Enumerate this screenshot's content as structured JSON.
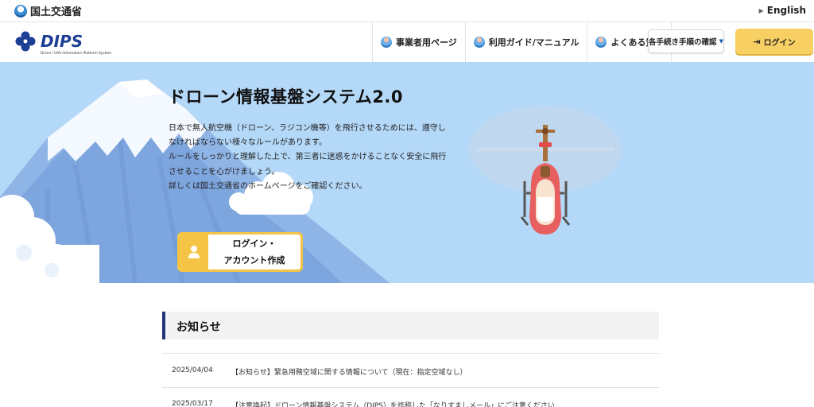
{
  "topbar": {
    "ministry_name": "国土交通省",
    "language_link": "English"
  },
  "header": {
    "logo_text": "DIPS",
    "logo_subtitle": "Drone / UAS Information Platform System",
    "nav": [
      {
        "label": "事業者用ページ",
        "icon": "person-icon"
      },
      {
        "label": "利用ガイド/マニュアル",
        "icon": "person-icon"
      },
      {
        "label": "よくある質問",
        "icon": "person-icon"
      }
    ],
    "procedure_button": "各手続き手順の確認",
    "login_button": "ログイン"
  },
  "hero": {
    "title": "ドローン情報基盤システム2.0",
    "description": [
      "日本で無人航空機（ドローン、ラジコン機等）を飛行させるためには、遵守し",
      "なければならない様々なルールがあります。",
      "ルールをしっかりと理解した上で、第三者に迷惑をかけることなく安全に飛行",
      "させることを心がけましょう。",
      "詳しくは国土交通省のホームページをご確認ください。"
    ],
    "account_button": {
      "line1": "ログイン・",
      "line2": "アカウント作成"
    }
  },
  "news": {
    "heading": "お知らせ",
    "items": [
      {
        "date": "2025/04/04",
        "text": "【お知らせ】緊急用務空域に関する情報について（現在：指定空域なし）"
      },
      {
        "date": "2025/03/17",
        "text": "【注意喚起】ドローン情報基盤システム（DIPS）を詐称した「なりすましメール」にご注意ください"
      }
    ]
  },
  "colors": {
    "hero_background": "#b4d8f8",
    "accent_yellow": "#f8cf63",
    "news_accent": "#24347a",
    "logo_blue": "#1c3f94"
  }
}
